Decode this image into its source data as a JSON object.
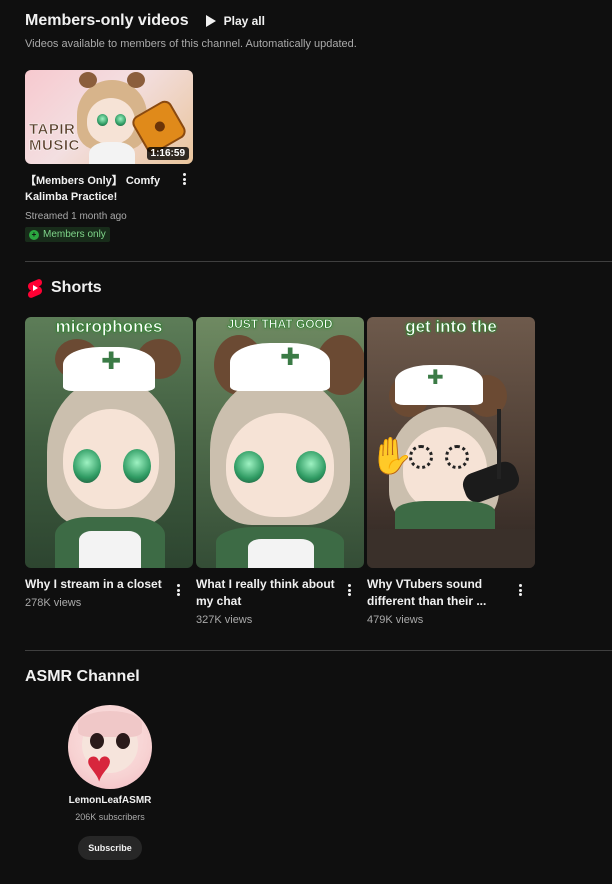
{
  "members": {
    "title": "Members-only videos",
    "play_all": "Play all",
    "description": "Videos available to members of this channel. Automatically updated.",
    "video": {
      "title": "【Members Only】 Comfy Kalimba Practice!",
      "duration": "1:16:59",
      "thumbnail_text": "TAPIR MUSIC",
      "meta": "Streamed 1 month ago",
      "badge": "Members only"
    }
  },
  "shorts": {
    "title": "Shorts",
    "items": [
      {
        "caption": "microphones",
        "title": "Why I stream in a closet",
        "views": "278K views"
      },
      {
        "caption": "JUST THAT GOOD",
        "title": "What I really think about my chat",
        "views": "327K views"
      },
      {
        "caption": "get into the",
        "title": "Why VTubers sound different than their ...",
        "views": "479K views"
      }
    ]
  },
  "asmr": {
    "title": "ASMR Channel",
    "channel_name": "LemonLeafASMR",
    "subscribers": "206K subscribers",
    "subscribe_label": "Subscribe"
  },
  "colors": {
    "background": "#0f0f0f",
    "text": "#f1f1f1",
    "secondary_text": "#aaaaaa",
    "shorts_red": "#ff0033",
    "members_green": "#2ba640"
  }
}
